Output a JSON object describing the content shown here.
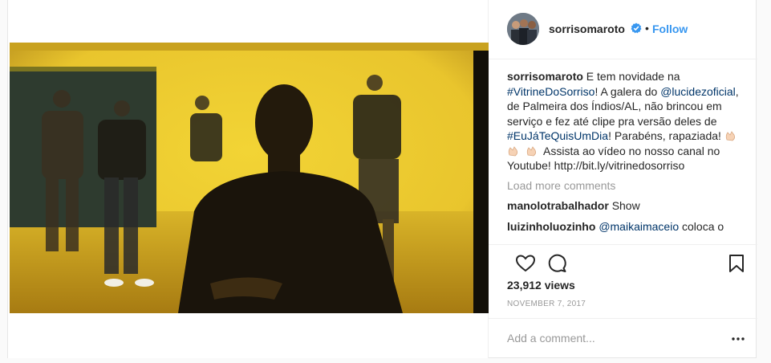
{
  "post": {
    "username": "sorrisomaroto",
    "separator": "•",
    "follow_label": "Follow",
    "caption": {
      "username": "sorrisomaroto",
      "t1": " E tem novidade na ",
      "hashtag1": "#VitrineDoSorriso",
      "t2": "! A galera do ",
      "mention1": "@lucidezoficial",
      "t3": ", de Palmeira dos Índios/AL, não brincou em serviço e fez até clipe pra versão deles de ",
      "hashtag2": "#EuJáTeQuisUmDia",
      "t4": "! Parabéns, rapaziada! ",
      "t5": " Assista ao vídeo no nosso canal no Youtube! http://bit.ly/vitrinedosorriso"
    },
    "load_more": "Load more comments",
    "comments": [
      {
        "username": "manolotrabalhador",
        "text": "Show"
      },
      {
        "username": "luizinholuozinho",
        "mention": "@maikaimaceio",
        "text": "coloca o"
      }
    ],
    "views": "23,912 views",
    "date": "NOVEMBER 7, 2017",
    "add_comment_placeholder": "Add a comment...",
    "icons": {
      "like": "heart-icon",
      "comment": "comment-icon",
      "save": "bookmark-icon",
      "more": "more-options-icon",
      "verified": "verified-badge-icon"
    },
    "colors": {
      "link": "#003569",
      "follow": "#3897f0",
      "verified": "#3897f0",
      "muted": "#999999"
    }
  }
}
